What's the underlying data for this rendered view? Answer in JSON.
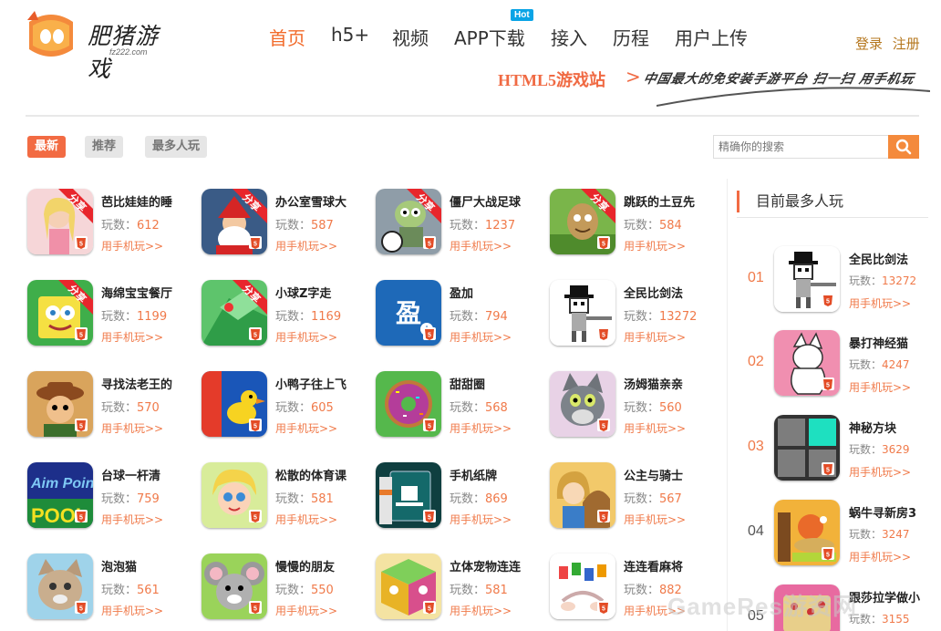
{
  "brand": {
    "name": "肥猪游戏",
    "domain": "fz222.com",
    "accent": "#f26b2b"
  },
  "nav": {
    "items": [
      "首页",
      "h5+",
      "视频",
      "APP下载",
      "接入",
      "历程",
      "用户上传"
    ],
    "active": "首页",
    "hot_badge": "Hot"
  },
  "auth": {
    "login": "登录",
    "register": "注册"
  },
  "slogan": {
    "title": "HTML5游戏站",
    "arrow": ">",
    "handwritten": "中国最大的免安装手游平台 扫一扫 用手机玩"
  },
  "filters": {
    "items": [
      "最新",
      "推荐",
      "最多人玩"
    ],
    "active": "最新"
  },
  "search": {
    "placeholder": "精确你的搜索",
    "icon": "search-icon"
  },
  "play_prefix": "玩数：",
  "play_link": "用手机玩>>",
  "games": [
    {
      "name": "芭比娃娃的睡",
      "plays": "612",
      "share": "分享",
      "icon": "barbie-thumb"
    },
    {
      "name": "办公室雪球大",
      "plays": "587",
      "share": "分享",
      "icon": "santa-thumb"
    },
    {
      "name": "僵尸大战足球",
      "plays": "1237",
      "share": "分享",
      "icon": "zombie-thumb"
    },
    {
      "name": "跳跃的土豆先",
      "plays": "584",
      "share": "分享",
      "icon": "potato-thumb"
    },
    {
      "name": "海绵宝宝餐厅",
      "plays": "1199",
      "share": "分享",
      "icon": "sponge-thumb"
    },
    {
      "name": "小球Z字走",
      "plays": "1169",
      "share": "分享",
      "icon": "zigzag-thumb"
    },
    {
      "name": "盈加",
      "plays": "794",
      "share": "",
      "icon": "yingjia-thumb"
    },
    {
      "name": "全民比剑法",
      "plays": "13272",
      "share": "",
      "icon": "sword-thumb"
    },
    {
      "name": "寻找法老王的",
      "plays": "570",
      "share": "",
      "icon": "explorer-thumb"
    },
    {
      "name": "小鸭子往上飞",
      "plays": "605",
      "share": "",
      "icon": "duck-thumb"
    },
    {
      "name": "甜甜圈",
      "plays": "568",
      "share": "",
      "icon": "donut-thumb"
    },
    {
      "name": "汤姆猫亲亲",
      "plays": "560",
      "share": "",
      "icon": "tomcat-thumb"
    },
    {
      "name": "台球一杆清",
      "plays": "759",
      "share": "",
      "icon": "pool-thumb"
    },
    {
      "name": "松散的体育课",
      "plays": "581",
      "share": "",
      "icon": "girl-thumb"
    },
    {
      "name": "手机纸牌",
      "plays": "869",
      "share": "",
      "icon": "cards-thumb"
    },
    {
      "name": "公主与骑士",
      "plays": "567",
      "share": "",
      "icon": "princess-thumb"
    },
    {
      "name": "泡泡猫",
      "plays": "561",
      "share": "",
      "icon": "bubblecat-thumb"
    },
    {
      "name": "慢慢的朋友",
      "plays": "550",
      "share": "",
      "icon": "mouse-thumb"
    },
    {
      "name": "立体宠物连连",
      "plays": "581",
      "share": "",
      "icon": "cube-thumb"
    },
    {
      "name": "连连看麻将",
      "plays": "882",
      "share": "",
      "icon": "mahjong-thumb"
    }
  ],
  "sidebar": {
    "title": "目前最多人玩",
    "items": [
      {
        "rank": "01",
        "name": "全民比剑法",
        "plays": "13272",
        "icon": "sword-thumb"
      },
      {
        "rank": "02",
        "name": "暴打神经猫",
        "plays": "4247",
        "icon": "crazycat-thumb"
      },
      {
        "rank": "03",
        "name": "神秘方块",
        "plays": "3629",
        "icon": "blocks-thumb"
      },
      {
        "rank": "04",
        "name": "蜗牛寻新房3",
        "plays": "3247",
        "icon": "snail-thumb"
      },
      {
        "rank": "05",
        "name": "跟莎拉学做小",
        "plays": "3155",
        "icon": "cooking-thumb"
      }
    ]
  },
  "watermark": "GameRes游资网"
}
